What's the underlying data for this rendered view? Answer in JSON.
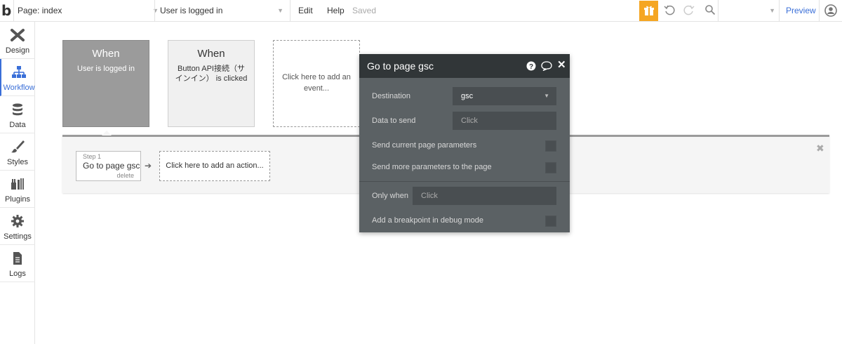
{
  "topbar": {
    "logo": "b",
    "page_label": "Page: index",
    "condition_label": "User is logged in",
    "edit": "Edit",
    "help": "Help",
    "saved": "Saved",
    "preview": "Preview",
    "accent_color": "#f5a623",
    "preview_color": "#3a6fd8"
  },
  "sidebar": {
    "items": [
      {
        "label": "Design",
        "icon": "design-icon"
      },
      {
        "label": "Workflow",
        "icon": "workflow-icon"
      },
      {
        "label": "Data",
        "icon": "database-icon"
      },
      {
        "label": "Styles",
        "icon": "brush-icon"
      },
      {
        "label": "Plugins",
        "icon": "plugins-icon"
      },
      {
        "label": "Settings",
        "icon": "gear-icon"
      },
      {
        "label": "Logs",
        "icon": "document-icon"
      }
    ],
    "active": "Workflow"
  },
  "events": [
    {
      "when": "When",
      "desc": "User is logged in"
    },
    {
      "when": "When",
      "desc": "Button API接続（サインイン） is clicked"
    },
    {
      "add": "Click here to add an event..."
    }
  ],
  "actions": {
    "step_number": "Step 1",
    "step_title": "Go to page gsc",
    "step_delete": "delete",
    "add_action": "Click here to add an action..."
  },
  "editor": {
    "title": "Go to page gsc",
    "destination_label": "Destination",
    "destination_value": "gsc",
    "data_label": "Data to send",
    "data_placeholder": "Click",
    "send_current_label": "Send current page parameters",
    "send_more_label": "Send more parameters to the page",
    "only_when_label": "Only when",
    "only_when_placeholder": "Click",
    "breakpoint_label": "Add a breakpoint in debug mode"
  }
}
